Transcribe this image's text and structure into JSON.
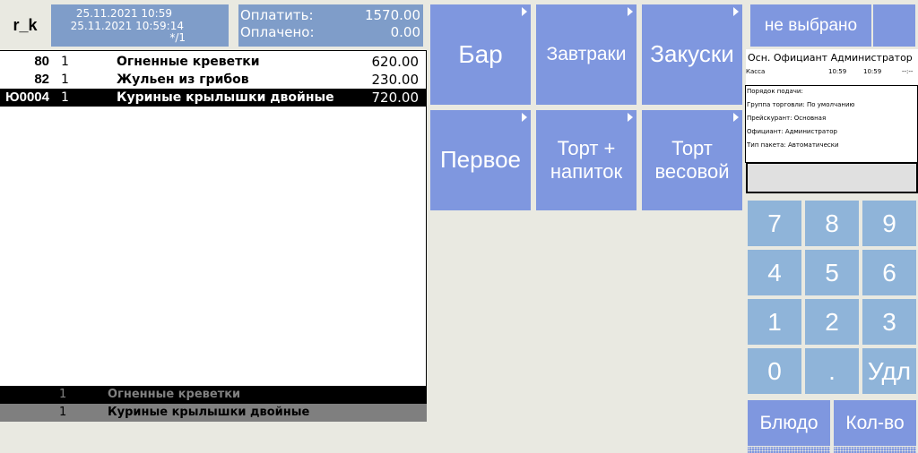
{
  "header": {
    "user": "r_k",
    "datetime_1": "25.11.2021 10:59",
    "datetime_2": "25.11.2021 10:59:14",
    "datetime_3": "*/1"
  },
  "payment": {
    "to_pay_label": "Оплатить:",
    "to_pay_value": "1570.00",
    "paid_label": "Оплачено:",
    "paid_value": "0.00"
  },
  "order": {
    "items": [
      {
        "code": "80",
        "qty": "1",
        "name": "Огненные креветки",
        "price": "620.00",
        "selected": false
      },
      {
        "code": "82",
        "qty": "1",
        "name": "Жульен из грибов",
        "price": "230.00",
        "selected": false
      },
      {
        "code": "Ю0004",
        "qty": "1",
        "name": "Куриные крылышки двойные",
        "price": "720.00",
        "selected": true
      }
    ]
  },
  "history": [
    {
      "qty": "1",
      "name": "Огненные креветки"
    },
    {
      "qty": "1",
      "name": "Куриные крылышки двойные"
    }
  ],
  "categories": [
    {
      "label": "Бар"
    },
    {
      "label": "Завтраки"
    },
    {
      "label": "Закуски"
    },
    {
      "label": "Первое"
    },
    {
      "label": "Торт + напиток"
    },
    {
      "label": "Торт весовой"
    }
  ],
  "right_panel": {
    "not_selected": "не выбрано",
    "info_head": "Осн. Официант  Администратор",
    "info_row": {
      "a": "Касса",
      "b": "10:59",
      "c": "10:59",
      "d": "--:--"
    },
    "info_lines": [
      "Порядок подачи:",
      "Группа торговли: По умолчанию",
      "Прейскурант: Основная",
      "Официант: Администратор",
      "Тип пакета: Автоматически"
    ]
  },
  "keypad": {
    "keys": [
      "7",
      "8",
      "9",
      "4",
      "5",
      "6",
      "1",
      "2",
      "3",
      "0",
      ".",
      "Удл"
    ],
    "dish_label": "Блюдо",
    "qty_label": "Кол-во"
  },
  "colors": {
    "category_button": "#7f97df",
    "keypad_button": "#8fb4d9",
    "header_box": "#7f9dc9",
    "background": "#e9e9e1"
  }
}
